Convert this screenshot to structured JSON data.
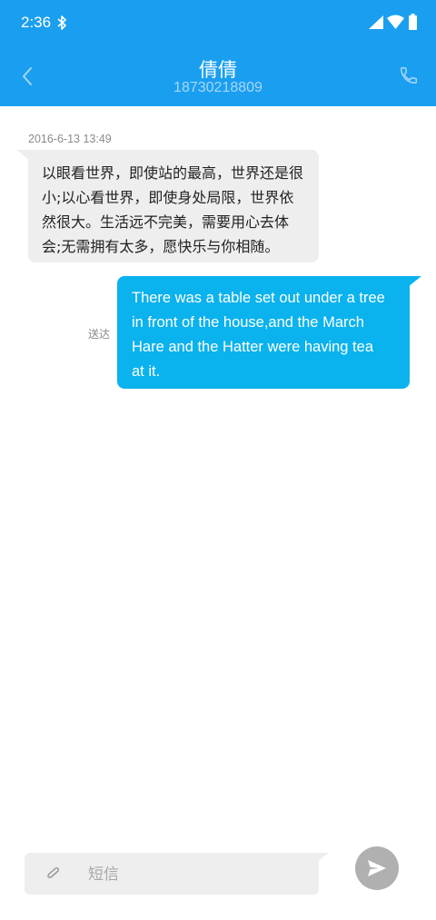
{
  "status_bar": {
    "time": "2:36",
    "icons": [
      "bluetooth-icon",
      "signal-icon",
      "wifi-icon",
      "battery-icon"
    ]
  },
  "header": {
    "contact_name": "倩倩",
    "phone_number": "18730218809",
    "left_icon": "back-icon",
    "right_icon": "phone-call-icon"
  },
  "conversation": {
    "timestamp": "2016-6-13 13:49",
    "incoming_message": {
      "lines": [
        "以眼看世界，即使站的最高，世界还是很",
        "小;以心看世界，即使身处局限，世界依",
        "然很大。生活远不完美，需要用心去体",
        "会;无需拥有太多，愿快乐与你相随。"
      ]
    },
    "outgoing_message": {
      "status": "送达",
      "lines": [
        "There was a table set out under a tree",
        "in front of the house,and the March",
        "Hare and the Hatter were having tea",
        "at it."
      ]
    }
  },
  "composer": {
    "placeholder": "短信",
    "value": "",
    "attach_icon": "paperclip-icon",
    "send_icon": "send-icon"
  },
  "colors": {
    "header_blue": "#1a9ff0",
    "outgoing_bubble": "#0ab2ee",
    "incoming_bubble": "#eeeeee",
    "send_button_disabled": "#b0b0b0"
  }
}
